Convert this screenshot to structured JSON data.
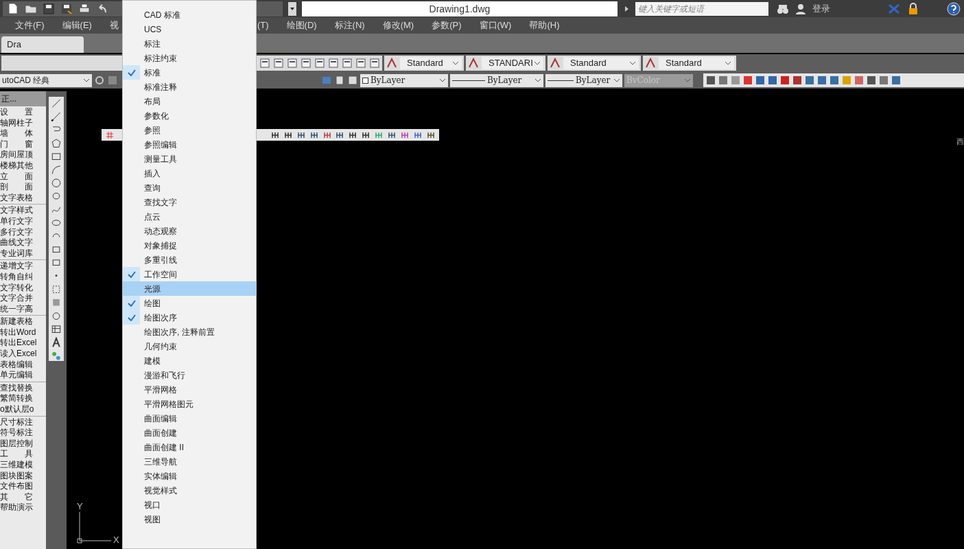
{
  "title_bar": {
    "title": "Drawing1.dwg",
    "search_placeholder": "键入关键字或短语",
    "sign_in": "登录"
  },
  "menu_bar": [
    "文件(F)",
    "编辑(E)",
    "视",
    "(T)",
    "绘图(D)",
    "标注(N)",
    "修改(M)",
    "参数(P)",
    "窗口(W)",
    "帮助(H)"
  ],
  "file_tabs": [
    {
      "label": "Dra",
      "selected": true
    }
  ],
  "style_toolbar": [
    "Standard",
    "STANDARI",
    "Standard",
    "Standard"
  ],
  "properties_toolbar": {
    "workspace": "utoCAD 经典",
    "color_setting": "ByLayer",
    "linetype": "ByLayer",
    "lineweight": "ByLayer",
    "plot_style": {
      "value": "BvColor",
      "disabled": true
    }
  },
  "side_menu": {
    "title": "正...",
    "groups": [
      [
        "设　　置",
        "轴网柱子",
        "墙　　体",
        "门　　窗",
        "房间屋顶",
        "楼梯其他",
        "立　　面",
        "剖　　面",
        "文字表格"
      ],
      [
        "文字样式",
        "单行文字",
        "多行文字",
        "曲线文字",
        "专业词库"
      ],
      [
        "递增文字",
        "转角自纠",
        "文字转化",
        "文字合并",
        "统一字高"
      ],
      [
        "新建表格",
        "转出Word",
        "转出Excel",
        "读入Excel",
        "表格编辑",
        "单元编辑"
      ],
      [
        "查找替换",
        "繁简转换",
        "o默认层o"
      ],
      [
        "尺寸标注",
        "符号标注",
        "图层控制",
        "工　　具",
        "三维建模",
        "图块图案",
        "文件布图",
        "其　　它",
        "帮助演示"
      ]
    ]
  },
  "context_menu": [
    {
      "label": "CAD 标准",
      "checked": false,
      "selected": false
    },
    {
      "label": "UCS",
      "checked": false,
      "selected": false
    },
    {
      "label": "标注",
      "checked": false,
      "selected": false
    },
    {
      "label": "标注约束",
      "checked": false,
      "selected": false
    },
    {
      "label": "标准",
      "checked": true,
      "selected": false
    },
    {
      "label": "标准注释",
      "checked": false,
      "selected": false
    },
    {
      "label": "布局",
      "checked": false,
      "selected": false
    },
    {
      "label": "参数化",
      "checked": false,
      "selected": false
    },
    {
      "label": "参照",
      "checked": false,
      "selected": false
    },
    {
      "label": "参照编辑",
      "checked": false,
      "selected": false
    },
    {
      "label": "测量工具",
      "checked": false,
      "selected": false
    },
    {
      "label": "插入",
      "checked": false,
      "selected": false
    },
    {
      "label": "查询",
      "checked": false,
      "selected": false
    },
    {
      "label": "查找文字",
      "checked": false,
      "selected": false
    },
    {
      "label": "点云",
      "checked": false,
      "selected": false
    },
    {
      "label": "动态观察",
      "checked": false,
      "selected": false
    },
    {
      "label": "对象捕捉",
      "checked": false,
      "selected": false
    },
    {
      "label": "多重引线",
      "checked": false,
      "selected": false
    },
    {
      "label": "工作空间",
      "checked": true,
      "selected": false
    },
    {
      "label": "光源",
      "checked": false,
      "selected": true
    },
    {
      "label": "绘图",
      "checked": true,
      "selected": false
    },
    {
      "label": "绘图次序",
      "checked": true,
      "selected": false
    },
    {
      "label": "绘图次序, 注释前置",
      "checked": false,
      "selected": false
    },
    {
      "label": "几何约束",
      "checked": false,
      "selected": false
    },
    {
      "label": "建模",
      "checked": false,
      "selected": false
    },
    {
      "label": "漫游和飞行",
      "checked": false,
      "selected": false
    },
    {
      "label": "平滑网格",
      "checked": false,
      "selected": false
    },
    {
      "label": "平滑网格图元",
      "checked": false,
      "selected": false
    },
    {
      "label": "曲面编辑",
      "checked": false,
      "selected": false
    },
    {
      "label": "曲面创建",
      "checked": false,
      "selected": false
    },
    {
      "label": "曲面创建 II",
      "checked": false,
      "selected": false
    },
    {
      "label": "三维导航",
      "checked": false,
      "selected": false
    },
    {
      "label": "实体编辑",
      "checked": false,
      "selected": false
    },
    {
      "label": "视觉样式",
      "checked": false,
      "selected": false
    },
    {
      "label": "视口",
      "checked": false,
      "selected": false
    },
    {
      "label": "视图",
      "checked": false,
      "selected": false
    }
  ],
  "view_cube_label": "西",
  "ucs": {
    "y": "Y",
    "x": "X"
  }
}
